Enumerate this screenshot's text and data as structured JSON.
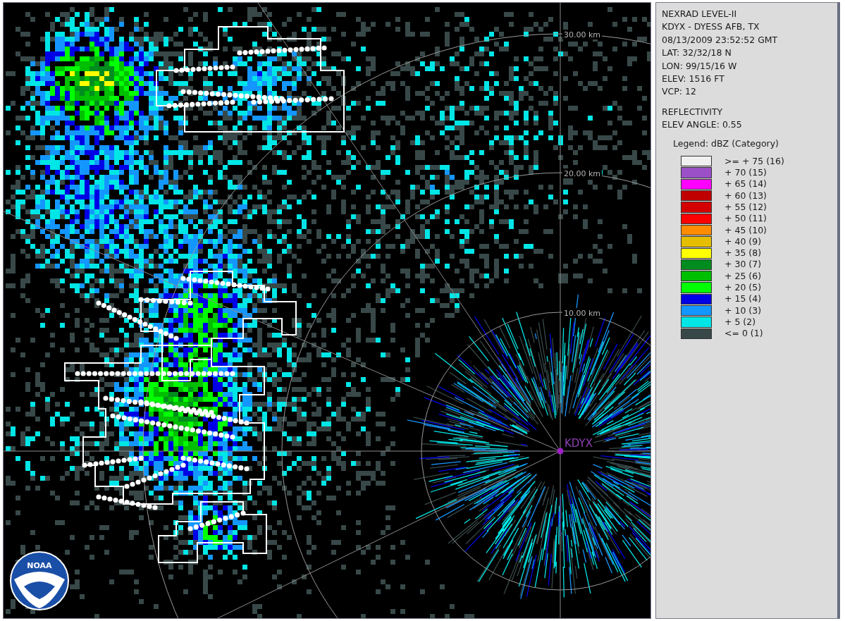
{
  "radar_map": {
    "range_labels": [
      "30.00 km",
      "20.00 km",
      "10.00 km"
    ],
    "station_label": "KDYX",
    "logo_text": "NOAA"
  },
  "info_panel": {
    "header_lines": [
      "NEXRAD LEVEL-II",
      "KDYX - DYESS AFB, TX",
      "08/13/2009 23:52:52 GMT",
      "LAT: 32/32/18 N",
      "LON: 99/15/16 W",
      "ELEV: 1516 FT",
      "VCP: 12"
    ],
    "product_lines": [
      "REFLECTIVITY",
      "ELEV ANGLE: 0.55"
    ],
    "legend_title": "Legend: dBZ (Category)",
    "legend": [
      {
        "label": ">= + 75 (16)",
        "color": "#f0f0f0"
      },
      {
        "label": "+ 70 (15)",
        "color": "#9b50c8"
      },
      {
        "label": "+ 65 (14)",
        "color": "#ff00ff"
      },
      {
        "label": "+ 60 (13)",
        "color": "#c00000"
      },
      {
        "label": "+ 55 (12)",
        "color": "#d40000"
      },
      {
        "label": "+ 50 (11)",
        "color": "#ff0000"
      },
      {
        "label": "+ 45 (10)",
        "color": "#ff8c00"
      },
      {
        "label": "+ 40 (9)",
        "color": "#e6be00"
      },
      {
        "label": "+ 35 (8)",
        "color": "#ffff00"
      },
      {
        "label": "+ 30 (7)",
        "color": "#008c1e"
      },
      {
        "label": "+ 25 (6)",
        "color": "#00be00"
      },
      {
        "label": "+ 20 (5)",
        "color": "#00ff00"
      },
      {
        "label": "+ 15 (4)",
        "color": "#0000e6"
      },
      {
        "label": "+ 10 (3)",
        "color": "#1496ff"
      },
      {
        "label": "+ 5 (2)",
        "color": "#00e6e6"
      },
      {
        "label": "<= 0 (1)",
        "color": "#384848"
      }
    ]
  }
}
